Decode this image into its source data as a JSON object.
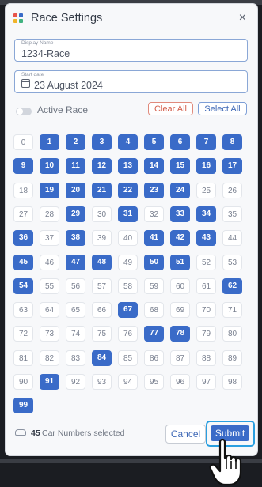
{
  "modal": {
    "title": "Race Settings",
    "close_glyph": "×",
    "logo_colors": [
      "#e8544a",
      "#3a6bc8",
      "#f0b429",
      "#3fb27f"
    ]
  },
  "display_name": {
    "label": "Display Name",
    "value": "1234-Race"
  },
  "start_date": {
    "label": "Start date",
    "value": "23 August 2024",
    "icon": "calendar-icon"
  },
  "active_race": {
    "label": "Active Race",
    "on": false
  },
  "buttons": {
    "clear_all": "Clear All",
    "select_all": "Select All",
    "cancel": "Cancel",
    "submit": "Submit"
  },
  "car_numbers": {
    "all": [
      "0",
      "1",
      "2",
      "3",
      "4",
      "5",
      "6",
      "7",
      "8",
      "9",
      "10",
      "11",
      "12",
      "13",
      "14",
      "15",
      "16",
      "17",
      "18",
      "19",
      "20",
      "21",
      "22",
      "23",
      "24",
      "25",
      "26",
      "27",
      "28",
      "29",
      "30",
      "31",
      "32",
      "33",
      "34",
      "35",
      "36",
      "37",
      "38",
      "39",
      "40",
      "41",
      "42",
      "43",
      "44",
      "45",
      "46",
      "47",
      "48",
      "49",
      "50",
      "51",
      "52",
      "53",
      "54",
      "55",
      "56",
      "57",
      "58",
      "59",
      "60",
      "61",
      "62",
      "63",
      "64",
      "65",
      "66",
      "67",
      "68",
      "69",
      "70",
      "71",
      "72",
      "73",
      "74",
      "75",
      "76",
      "77",
      "78",
      "79",
      "80",
      "81",
      "82",
      "83",
      "84",
      "85",
      "86",
      "87",
      "88",
      "89",
      "90",
      "91",
      "92",
      "93",
      "94",
      "95",
      "96",
      "97",
      "98",
      "99"
    ],
    "selected": [
      "1",
      "2",
      "3",
      "4",
      "5",
      "6",
      "7",
      "8",
      "9",
      "10",
      "11",
      "12",
      "13",
      "14",
      "15",
      "16",
      "17",
      "19",
      "20",
      "21",
      "22",
      "23",
      "24",
      "29",
      "31",
      "33",
      "34",
      "36",
      "38",
      "41",
      "42",
      "43",
      "45",
      "47",
      "48",
      "50",
      "51",
      "54",
      "62",
      "67",
      "77",
      "78",
      "84",
      "91",
      "99"
    ]
  },
  "footer": {
    "count": "45",
    "count_label": "Car Numbers selected",
    "icon": "car-icon"
  },
  "colors": {
    "accent": "#3a6bc8",
    "danger": "#d4614e",
    "focus_ring": "#2a9fe0"
  }
}
